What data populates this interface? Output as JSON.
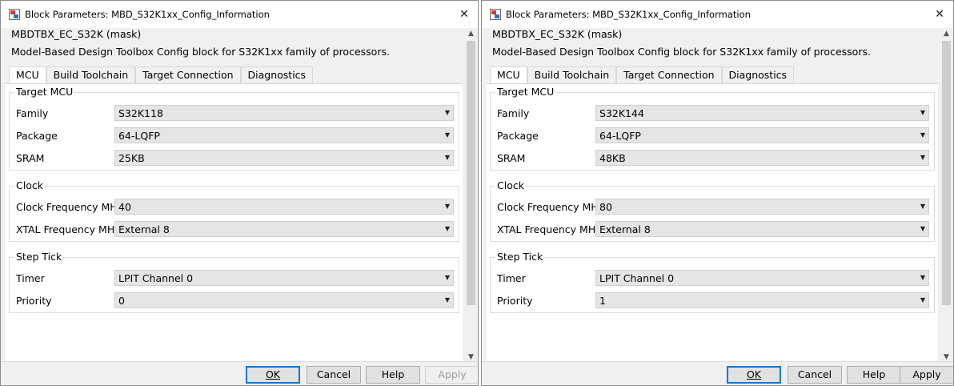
{
  "dialogs": [
    {
      "title": "Block Parameters: MBD_S32K1xx_Config_Information",
      "mask_title": "MBDTBX_EC_S32K (mask)",
      "description": "Model-Based Design Toolbox Config block for S32K1xx family of processors.",
      "tabs": [
        {
          "label": "MCU"
        },
        {
          "label": "Build Toolchain"
        },
        {
          "label": "Target Connection"
        },
        {
          "label": "Diagnostics"
        }
      ],
      "groups": {
        "target_mcu": {
          "title": "Target MCU",
          "family_label": "Family",
          "family": "S32K118",
          "package_label": "Package",
          "package": "64-LQFP",
          "sram_label": "SRAM",
          "sram": "25KB"
        },
        "clock": {
          "title": "Clock",
          "clock_freq_label": "Clock Frequency MHz",
          "clock_freq": "40",
          "xtal_label": "XTAL Frequency MHz",
          "xtal": "External 8"
        },
        "step_tick": {
          "title": "Step Tick",
          "timer_label": "Timer",
          "timer": "LPIT Channel 0",
          "priority_label": "Priority",
          "priority": "0"
        }
      },
      "buttons": {
        "ok": "OK",
        "cancel": "Cancel",
        "help": "Help",
        "apply": "Apply"
      }
    },
    {
      "title": "Block Parameters: MBD_S32K1xx_Config_Information",
      "mask_title": "MBDTBX_EC_S32K (mask)",
      "description": "Model-Based Design Toolbox Config block for S32K1xx family of processors.",
      "tabs": [
        {
          "label": "MCU"
        },
        {
          "label": "Build Toolchain"
        },
        {
          "label": "Target Connection"
        },
        {
          "label": "Diagnostics"
        }
      ],
      "groups": {
        "target_mcu": {
          "title": "Target MCU",
          "family_label": "Family",
          "family": "S32K144",
          "package_label": "Package",
          "package": "64-LQFP",
          "sram_label": "SRAM",
          "sram": "48KB"
        },
        "clock": {
          "title": "Clock",
          "clock_freq_label": "Clock Frequency MHz",
          "clock_freq": "80",
          "xtal_label": "XTAL Frequency MHz",
          "xtal": "External 8"
        },
        "step_tick": {
          "title": "Step Tick",
          "timer_label": "Timer",
          "timer": "LPIT Channel 0",
          "priority_label": "Priority",
          "priority": "1"
        }
      },
      "buttons": {
        "ok": "OK",
        "cancel": "Cancel",
        "help": "Help",
        "apply": "Apply"
      }
    }
  ],
  "icons": {
    "close": "close-icon",
    "app": "simulink-block-icon",
    "scroll_up": "chevron-up-icon",
    "scroll_down": "chevron-down-icon"
  },
  "colors": {
    "dialog_bg": "#f0f0f0",
    "panel_bg": "#ffffff",
    "select_bg": "#e5e5e5",
    "default_button_border": "#0078d7"
  }
}
